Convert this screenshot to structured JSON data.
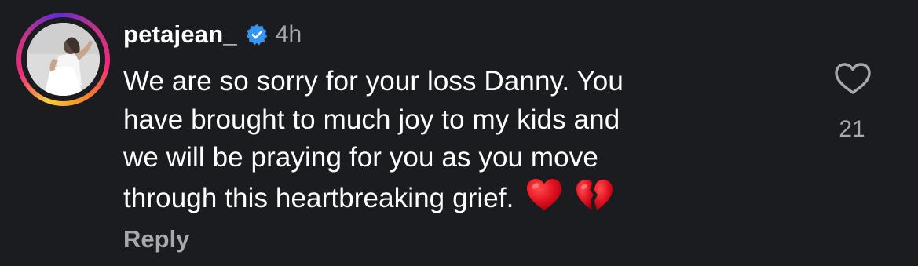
{
  "comment": {
    "username": "petajean_",
    "verified": true,
    "time": "4h",
    "lines": [
      "We are so sorry for your loss Danny. You",
      "have brought to much joy to my kids and",
      "we will be praying for you as you move",
      "through this heartbreaking grief."
    ],
    "reply_label": "Reply",
    "like_count": "21",
    "emojis": [
      "red-heart",
      "broken-heart"
    ]
  },
  "colors": {
    "background": "#1b1c20",
    "text": "#ffffff",
    "muted": "#a8a9ad",
    "verified_badge": "#3797f0",
    "heart_red": "#e0101f"
  },
  "icons": [
    "verified-badge-icon",
    "heart-outline-icon",
    "red-heart-emoji",
    "broken-heart-emoji"
  ]
}
